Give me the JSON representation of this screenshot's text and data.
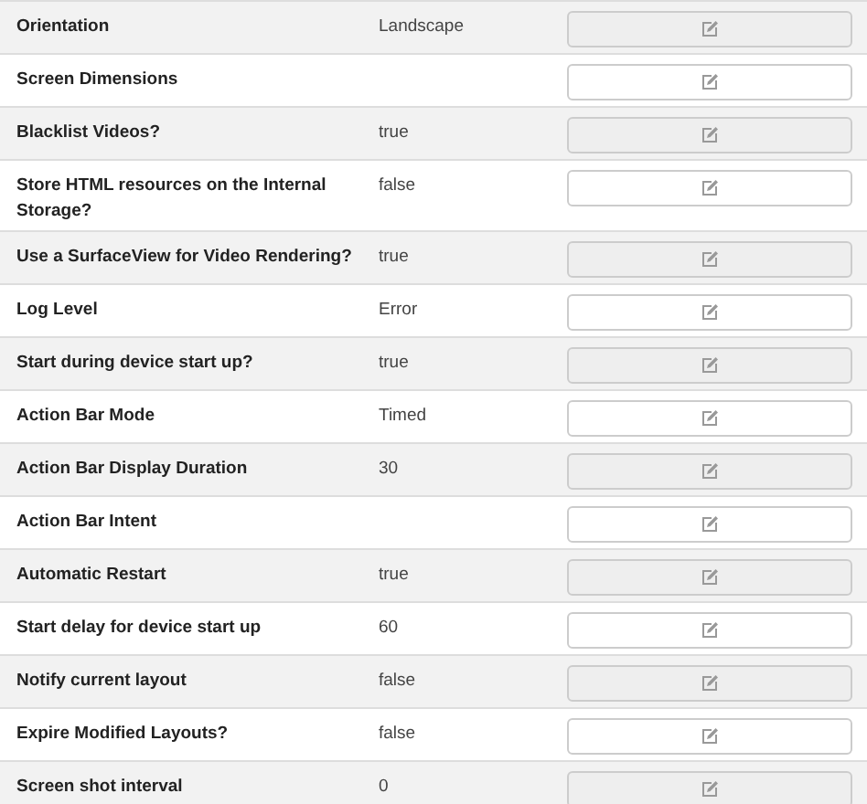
{
  "settings": [
    {
      "label": "Orientation",
      "value": "Landscape"
    },
    {
      "label": "Screen Dimensions"
    },
    {
      "label": "Blacklist Videos?",
      "value": "true"
    },
    {
      "label": "Store HTML resources on the Internal Storage?",
      "value": "false"
    },
    {
      "label": "Use a SurfaceView for Video Rendering?",
      "value": "true"
    },
    {
      "label": "Log Level",
      "value": "Error"
    },
    {
      "label": "Start during device start up?",
      "value": "true"
    },
    {
      "label": "Action Bar Mode",
      "value": "Timed"
    },
    {
      "label": "Action Bar Display Duration",
      "value": "30"
    },
    {
      "label": "Action Bar Intent"
    },
    {
      "label": "Automatic Restart",
      "value": "true"
    },
    {
      "label": "Start delay for device start up",
      "value": "60"
    },
    {
      "label": "Notify current layout",
      "value": "false"
    },
    {
      "label": "Expire Modified Layouts?",
      "value": "false"
    },
    {
      "label": "Screen shot interval",
      "value": "0"
    }
  ]
}
